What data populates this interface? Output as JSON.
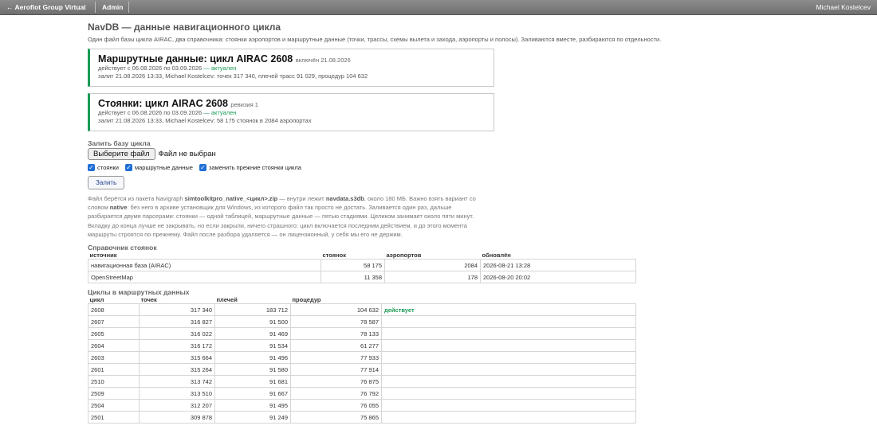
{
  "topbar": {
    "brand": "← Aeroflot Group Virtual",
    "admin": "Admin",
    "user": "Michael Kostelcev"
  },
  "page": {
    "title": "NavDB — данные навигационного цикла",
    "subtitle": "Один файл базы цикла AIRAC, два справочника: стоянки аэропортов и маршрутные данные (точки, трассы, схемы вылета и захода, аэропорты и полосы). Заливаются вместе, разбираются по отдельности."
  },
  "cards": [
    {
      "title": "Маршрутные данные: цикл AIRAC 2608",
      "suffix": "включён 21.08.2026",
      "validity": "действует с 06.08.2026 по 03.09.2026",
      "status": "— актуален",
      "meta": "залит 21.08.2026 13:33, Michael Kostelcev: точек 317 340, плечей трасс 91 029, процедур 104 632"
    },
    {
      "title": "Стоянки: цикл AIRAC 2608",
      "suffix": "ревизия 1",
      "validity": "действует с 06.08.2026 по 03.09.2026",
      "status": "— актуален",
      "meta": "залит 21.08.2026 13:33, Michael Kostelcev: 58 175 стоянок в 2084 аэропортах"
    }
  ],
  "upload": {
    "heading": "Залить базу цикла",
    "file_button": "Выберите файл",
    "file_status": "Файл не выбран",
    "checkboxes": [
      "стоянки",
      "маршрутные данные",
      "заменить прежние стоянки цикла"
    ],
    "submit": "Залить",
    "help": {
      "p1": "Файл берётся из пакета Navigraph ",
      "b1": "simtoolkitpro_native_<цикл>.zip",
      "p2": " — внутри лежит ",
      "b2": "navdata.s3db",
      "p3": ", около 180 МБ. Важно взять вариант со словом ",
      "b3": "native",
      "p4": ": без него в архиве установщик для Windows, из которого файл так просто не достать. Заливается один раз, дальше разбирается двумя парсерами: стоянки — одной таблицей, маршрутные данные — пятью стадиями. Целиком занимает около пяти минут. Вкладку до конца лучше не закрывать, но если закрыли, ничего страшного: цикл включается последним действием, и до этого момента маршруты строятся по прежнему. Файл после разбора удаляется — он лицензионный, у себя мы его не держим."
    }
  },
  "stands": {
    "heading": "Справочник стоянок",
    "columns": [
      "источник",
      "стоянок",
      "аэропортов",
      "обновлён"
    ],
    "rows": [
      [
        "навигационная база (AIRAC)",
        "58 175",
        "2084",
        "2026-08-21 13:28"
      ],
      [
        "OpenStreetMap",
        "11 358",
        "178",
        "2026-08-20 20:02"
      ]
    ]
  },
  "cycles": {
    "heading": "Циклы в маршрутных данных",
    "columns": [
      "цикл",
      "точек",
      "плечей",
      "процедур"
    ],
    "rows": [
      [
        "2608",
        "317 340",
        "183 712",
        "104 632",
        "действует"
      ],
      [
        "2607",
        "316 827",
        "91 500",
        "78 587",
        ""
      ],
      [
        "2605",
        "316 022",
        "91 469",
        "78 133",
        ""
      ],
      [
        "2604",
        "316 172",
        "91 534",
        "61 277",
        ""
      ],
      [
        "2603",
        "315 664",
        "91 496",
        "77 933",
        ""
      ],
      [
        "2601",
        "315 264",
        "91 580",
        "77 914",
        ""
      ],
      [
        "2510",
        "313 742",
        "91 681",
        "76 875",
        ""
      ],
      [
        "2509",
        "313 510",
        "91 667",
        "76 792",
        ""
      ],
      [
        "2504",
        "312 207",
        "91 495",
        "76 055",
        ""
      ],
      [
        "2501",
        "309 878",
        "91 249",
        "75 865",
        ""
      ]
    ]
  }
}
